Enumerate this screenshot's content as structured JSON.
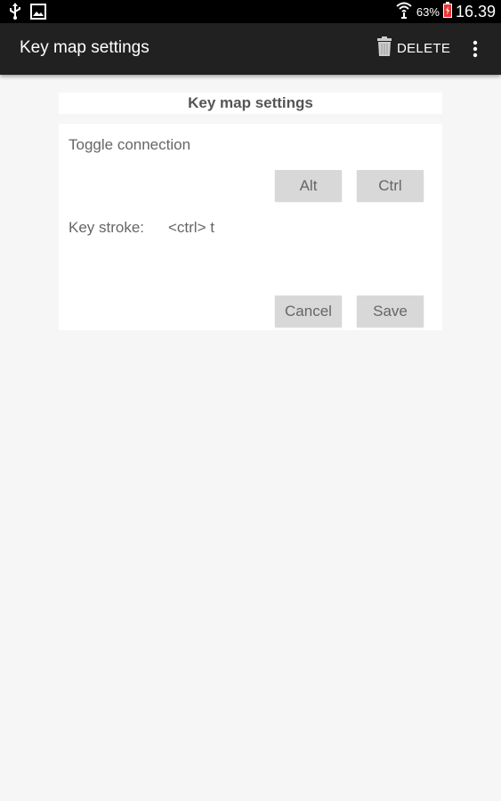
{
  "status_bar": {
    "battery_percent": "63%",
    "time": "16.39",
    "icons": [
      "usb-icon",
      "image-notification-icon",
      "wifi-icon",
      "battery-charging-icon"
    ]
  },
  "action_bar": {
    "title": "Key map settings",
    "delete_label": "DELETE",
    "icons": [
      "trash-icon",
      "overflow-menu-icon"
    ]
  },
  "dialog": {
    "title": "Key map settings",
    "section_label": "Toggle connection",
    "alt_label": "Alt",
    "ctrl_label": "Ctrl",
    "keystroke_label": "Key stroke:",
    "keystroke_value": "<ctrl> t",
    "cancel_label": "Cancel",
    "save_label": "Save"
  },
  "colors": {
    "action_bar": "#212121",
    "status_bar": "#000000",
    "background": "#f6f6f6",
    "button": "#d8d8d8",
    "text": "#666666"
  }
}
